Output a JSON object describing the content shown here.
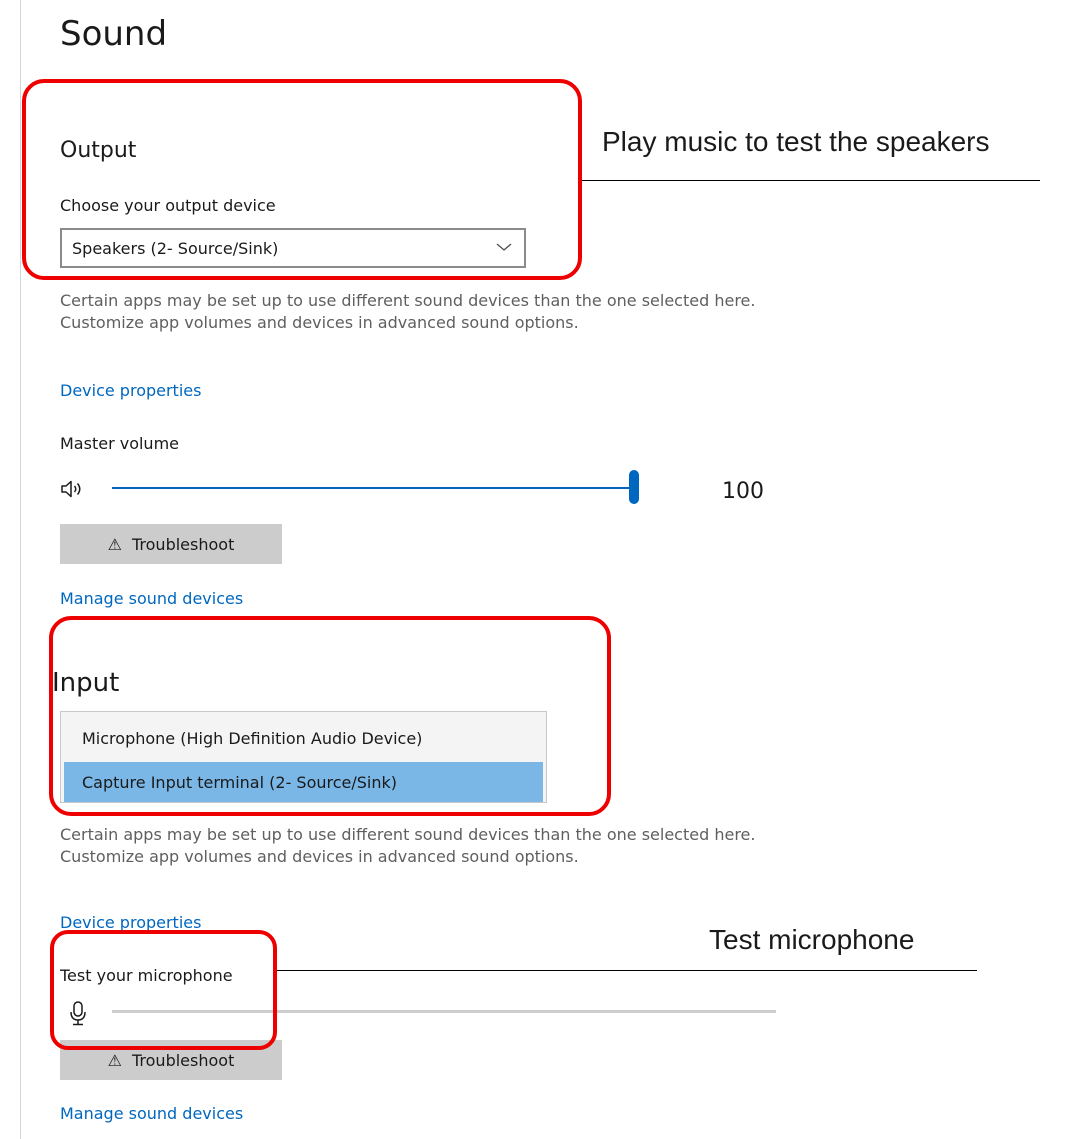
{
  "page": {
    "title": "Sound"
  },
  "output": {
    "title": "Output",
    "choose_label": "Choose your output device",
    "selected_device": "Speakers (2- Source/Sink)",
    "description": "Certain apps may be set up to use different sound devices than the one selected here. Customize app volumes and devices in advanced sound options.",
    "device_properties": "Device properties",
    "master_volume_label": "Master volume",
    "master_volume_value": "100",
    "master_volume_level": 100,
    "troubleshoot_label": "Troubleshoot",
    "manage_devices": "Manage sound devices"
  },
  "input": {
    "title": "Input",
    "options": [
      {
        "label": "Microphone (High Definition Audio Device)",
        "selected": false
      },
      {
        "label": "Capture Input terminal (2- Source/Sink)",
        "selected": true
      }
    ],
    "description": "Certain apps may be set up to use different sound devices than the one selected here. Customize app volumes and devices in advanced sound options.",
    "device_properties": "Device properties",
    "test_label": "Test your microphone",
    "troubleshoot_label": "Troubleshoot",
    "manage_devices": "Manage sound devices"
  },
  "annotations": {
    "speakers_note": "Play music to test the speakers",
    "mic_note": "Test microphone",
    "box_color": "#ee0000"
  },
  "icons": {
    "volume": "speaker-volume-icon",
    "chevron": "chevron-down-icon",
    "warning": "warning-triangle-icon",
    "microphone": "microphone-icon"
  },
  "colors": {
    "accent": "#0067c0",
    "link": "#0067c0",
    "selected_option": "#7ab7e6",
    "button": "#cccccc"
  }
}
